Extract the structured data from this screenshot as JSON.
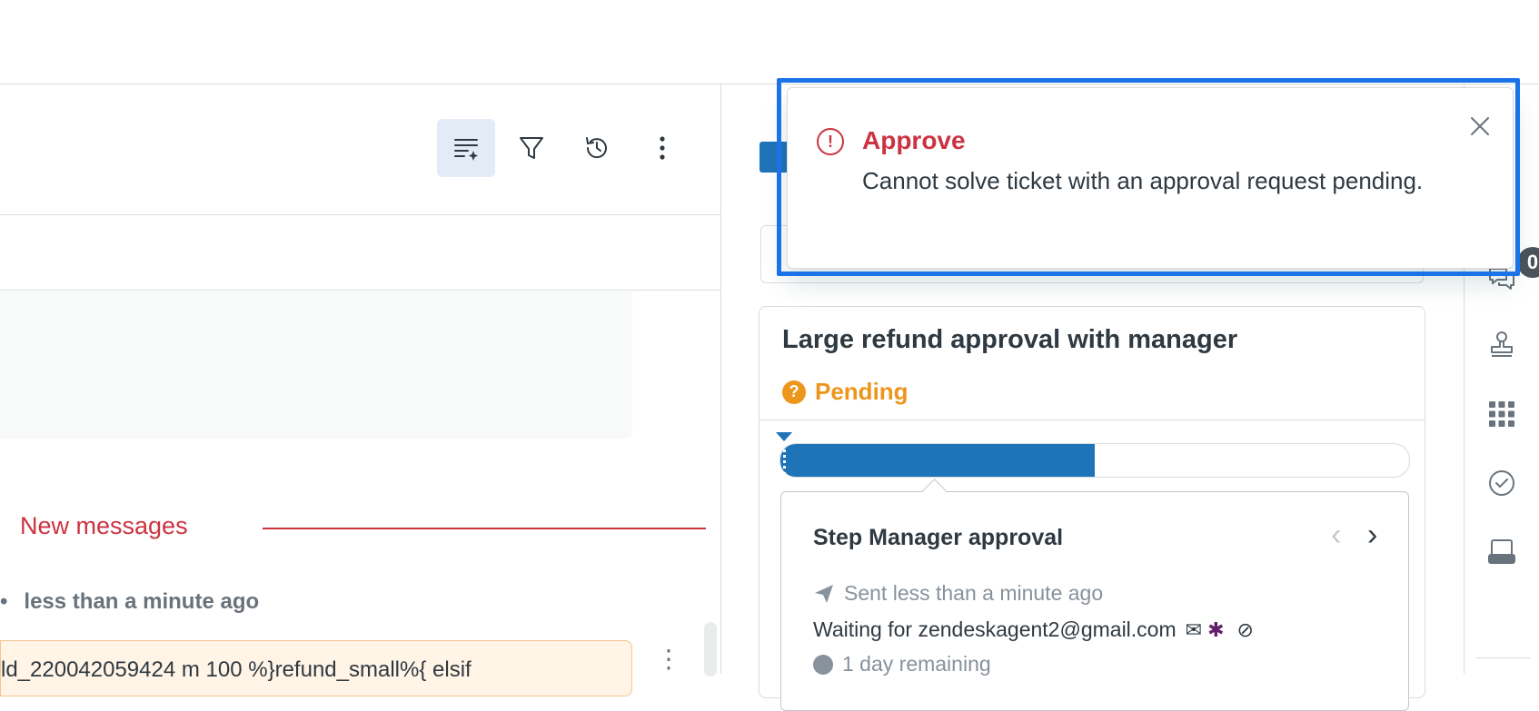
{
  "conversation": {
    "new_messages_label": "New messages",
    "timestamp": "less than a minute ago",
    "message_preview": "ld_220042059424 m 100 %}refund_small%{ elsif"
  },
  "approval": {
    "title": "Large refund approval with manager",
    "status": "Pending",
    "status_color": "#ed961c",
    "progress_fraction": 0.5,
    "step": {
      "title": "Step Manager approval",
      "sent": "Sent less than a minute ago",
      "waiting": "Waiting for zendeskagent2@gmail.com",
      "remaining": "1 day remaining"
    }
  },
  "rail": {
    "badge": "0"
  },
  "toast": {
    "title": "Approve",
    "message": "Cannot solve ticket with an approval request pending.",
    "error_color": "#cc3340"
  },
  "icons": {
    "toolbar": [
      "ai-summary-icon",
      "filter-icon",
      "history-icon",
      "more-vertical-icon"
    ],
    "rail": [
      "conversations-icon",
      "stamp-icon",
      "apps-grid-icon",
      "check-circle-icon",
      "device-icon"
    ]
  }
}
